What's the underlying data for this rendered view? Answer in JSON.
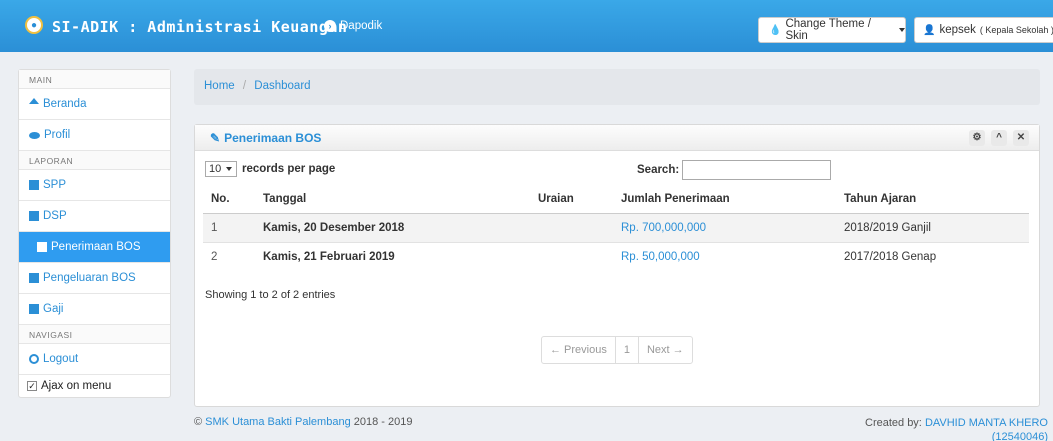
{
  "navbar": {
    "brand": "SI-ADIK : Administrasi Keuangan",
    "dapodik": "Dapodik",
    "theme_button": "Change Theme / Skin",
    "user_name": "kepsek",
    "user_role": "( Kepala Sekolah )"
  },
  "sidebar": {
    "section_main": "MAIN",
    "beranda": "Beranda",
    "profil": "Profil",
    "section_laporan": "LAPORAN",
    "spp": "SPP",
    "dsp": "DSP",
    "penerimaan_bos": "Penerimaan BOS",
    "pengeluaran_bos": "Pengeluaran BOS",
    "gaji": "Gaji",
    "section_navigasi": "NAVIGASI",
    "logout": "Logout",
    "ajax_label": "Ajax on menu"
  },
  "breadcrumb": {
    "home": "Home",
    "separator": "/",
    "current": "Dashboard"
  },
  "panel": {
    "title": "Penerimaan BOS",
    "records_value": "10",
    "records_label": "records per page",
    "search_label": "Search:",
    "search_value": "",
    "columns": [
      "No.",
      "Tanggal",
      "Uraian",
      "Jumlah Penerimaan",
      "Tahun Ajaran"
    ],
    "rows": [
      {
        "no": "1",
        "tanggal": "Kamis, 20 Desember 2018",
        "uraian": "",
        "jumlah": "Rp. 700,000,000",
        "tahun": "2018/2019 Ganjil"
      },
      {
        "no": "2",
        "tanggal": "Kamis, 21 Februari 2019",
        "uraian": "",
        "jumlah": "Rp. 50,000,000",
        "tahun": "2017/2018 Genap"
      }
    ],
    "showing": "Showing 1 to 2 of 2 entries",
    "pager": {
      "previous": "← Previous",
      "page": "1",
      "next": "Next →"
    }
  },
  "footer": {
    "copyright_symbol": "©",
    "school": "SMK Utama Bakti Palembang",
    "years": "2018 - 2019",
    "created_label": "Created by:",
    "creator": "DAVHID MANTA KHERO",
    "creator_id": "(12540046)"
  }
}
